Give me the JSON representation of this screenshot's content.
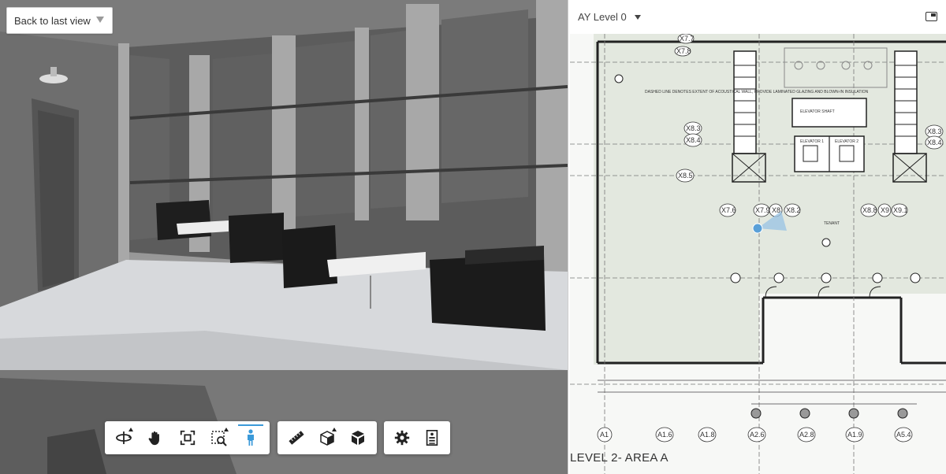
{
  "viewer": {
    "back_button_label": "Back to last view"
  },
  "toolbar": {
    "navigation_tools": [
      {
        "name": "orbit",
        "icon": "orbit-icon",
        "has_submenu": true
      },
      {
        "name": "pan",
        "icon": "hand-icon",
        "has_submenu": false
      },
      {
        "name": "fit-to-view",
        "icon": "fit-view-icon",
        "has_submenu": false
      },
      {
        "name": "zoom-window",
        "icon": "zoom-window-icon",
        "has_submenu": true
      },
      {
        "name": "first-person",
        "icon": "person-icon",
        "has_submenu": false,
        "active": true
      }
    ],
    "model_tools": [
      {
        "name": "measure",
        "icon": "ruler-icon",
        "has_submenu": false
      },
      {
        "name": "section",
        "icon": "section-box-icon",
        "has_submenu": true
      },
      {
        "name": "explode",
        "icon": "cube-explode-icon",
        "has_submenu": false
      }
    ],
    "settings_tools": [
      {
        "name": "settings",
        "icon": "gear-icon",
        "has_submenu": false
      },
      {
        "name": "properties",
        "icon": "properties-icon",
        "has_submenu": false
      }
    ],
    "accent_color": "#3b9ad9"
  },
  "sheet": {
    "level_selector_label": "AY Level 0",
    "area_label": "LEVEL 2- AREA A",
    "grid_labels_top": [
      "X7.7",
      "X7.8"
    ],
    "grid_labels_mid": [
      "X8.3",
      "X8.4",
      "X8.5",
      "X7.6",
      "X7.9",
      "X8",
      "X8.2",
      "X8.8",
      "X9",
      "X9.1",
      "X8.3",
      "X8.4"
    ],
    "grid_labels_bottom": [
      "A1",
      "A1.6",
      "A1.8",
      "A2.6",
      "A2.8",
      "A1.9",
      "A5.4"
    ],
    "room_labels": [
      "ELEVATOR SHAFT",
      "ELEVATOR 1",
      "ELEVATOR 2",
      "TENANT"
    ],
    "note_text": "DASHED LINE DENOTES EXTENT OF ACOUSTICAL WALL, PROVIDE LAMINATED GLAZING AND BLOWN-IN INSULATION",
    "camera_marker_color": "#5aa0d8"
  }
}
